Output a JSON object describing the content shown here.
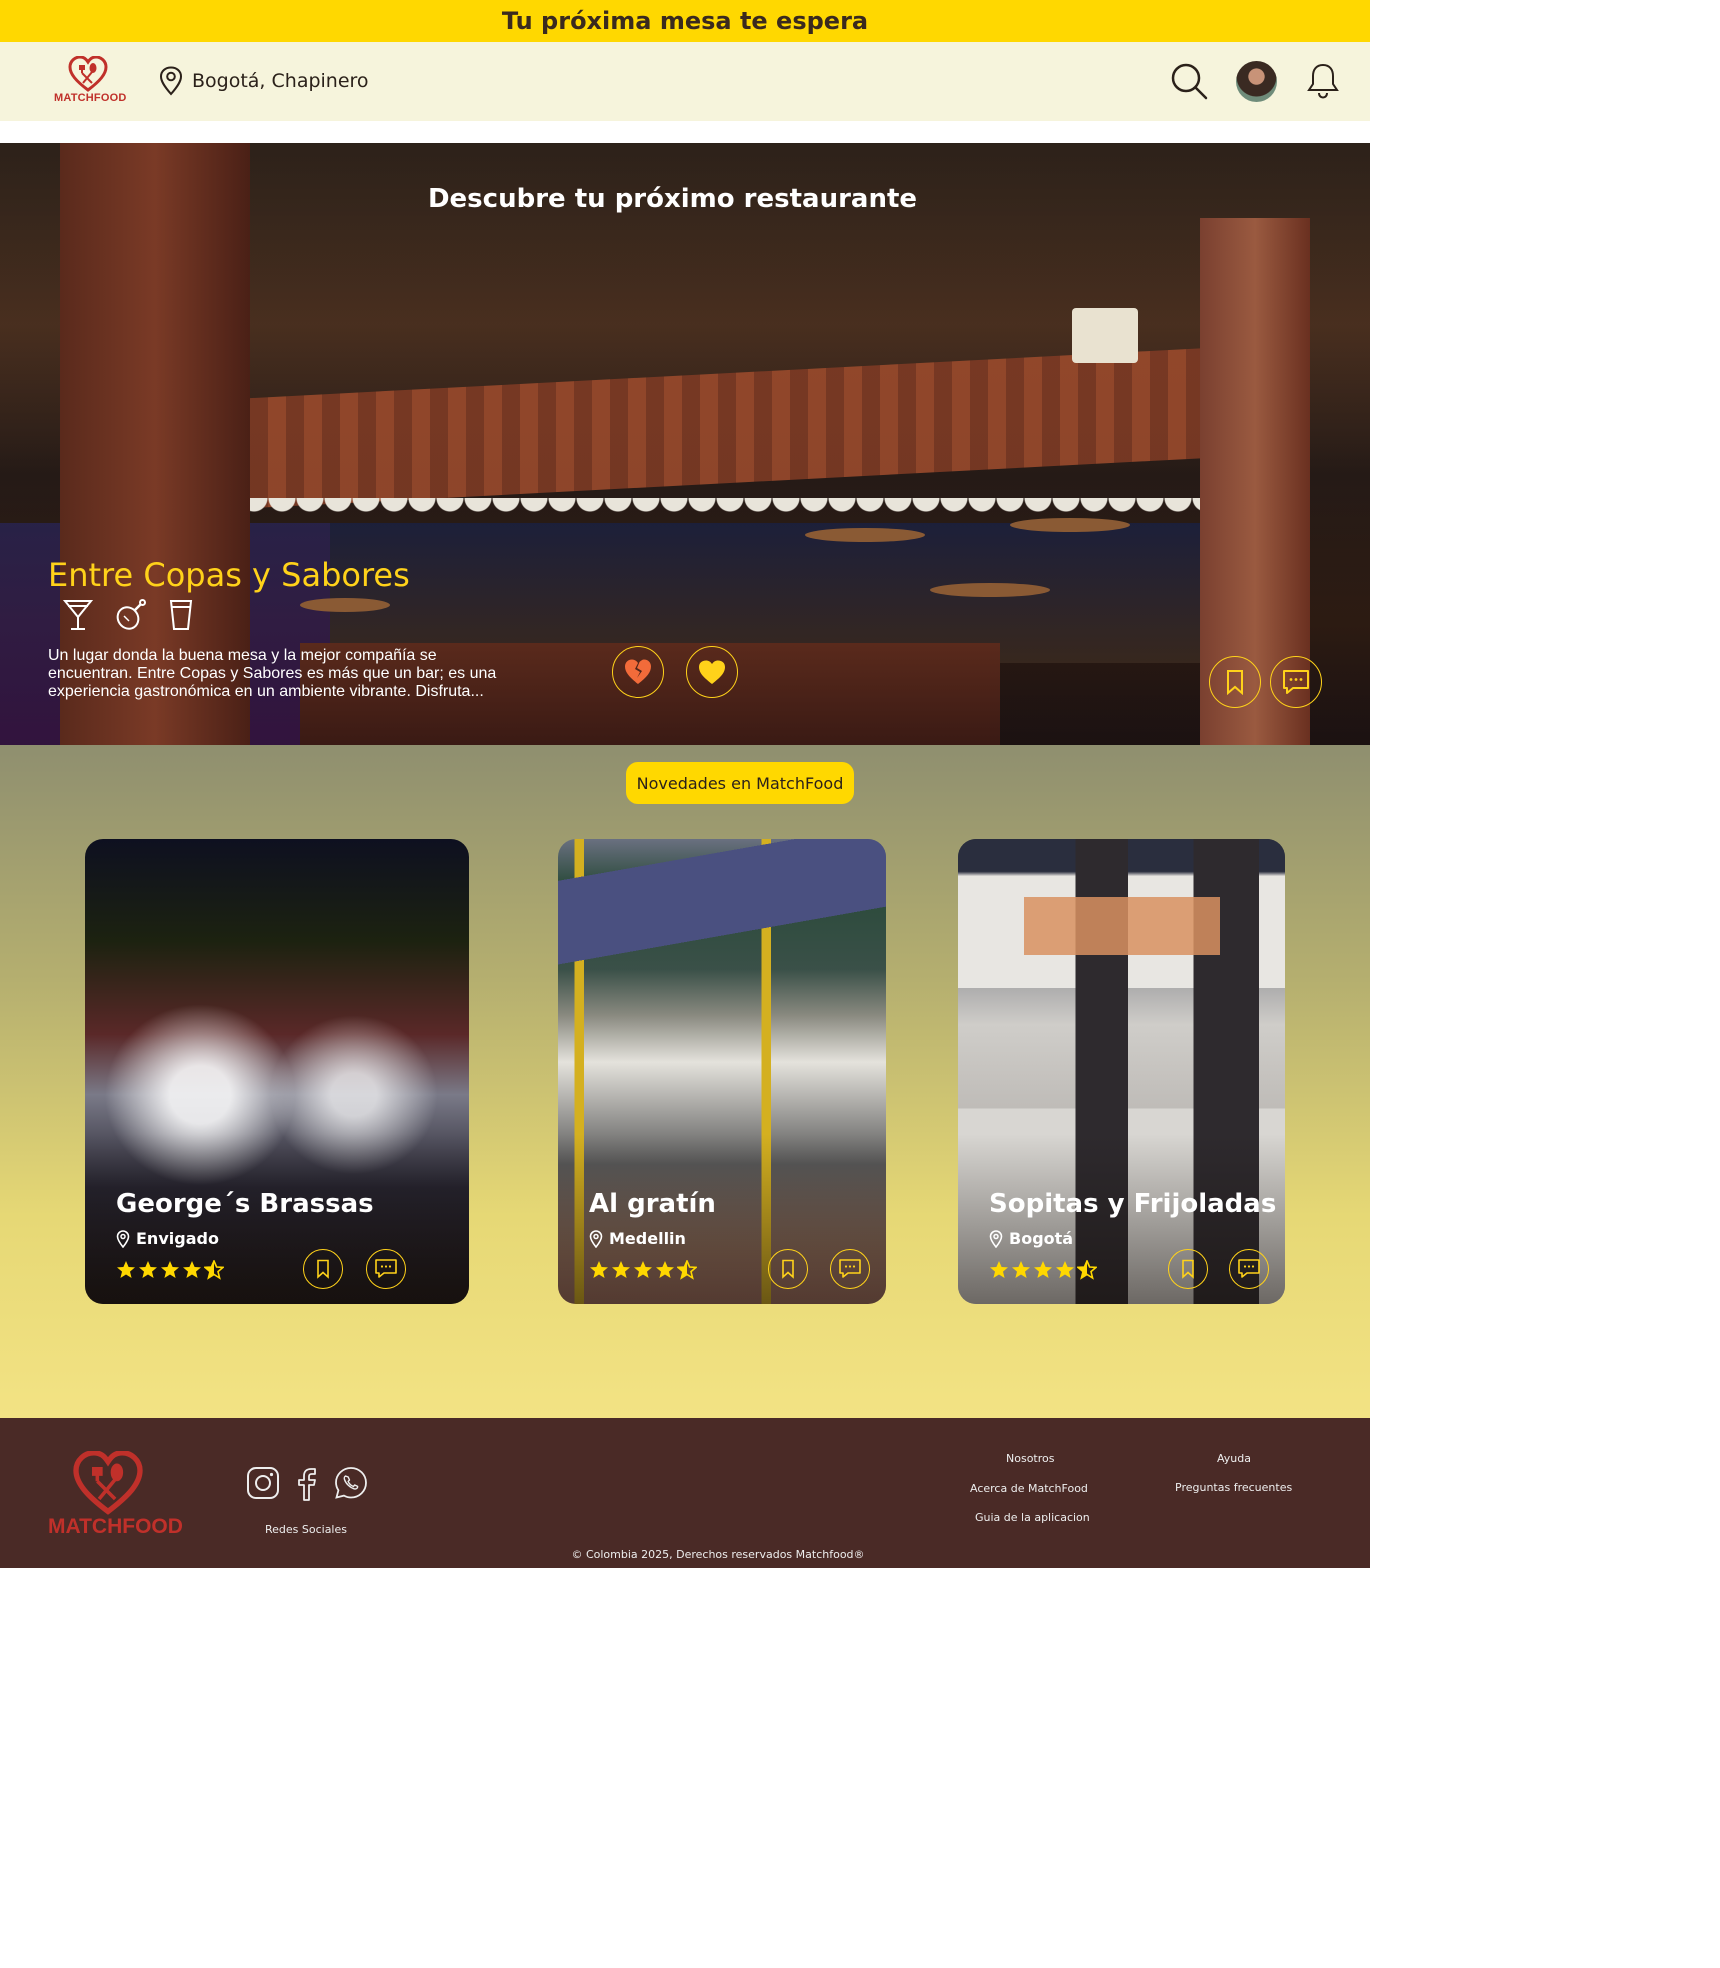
{
  "banner": {
    "text": "Tu próxima mesa te espera"
  },
  "header": {
    "logo_text": "MATCHFOOD",
    "location": "Bogotá, Chapinero"
  },
  "hero": {
    "title": "Descubre tu próximo restaurante",
    "restaurant_name": "Entre Copas y Sabores",
    "description": "Un lugar donda la buena mesa y la mejor compañía se encuentran. Entre Copas y Sabores es más que un bar; es una experiencia gastronómica en un ambiente vibrante. Disfruta...",
    "category_icons": [
      "cocktail-icon",
      "chicken-leg-icon",
      "beer-glass-icon"
    ]
  },
  "news": {
    "label": "Novedades en MatchFood",
    "cards": [
      {
        "name": "George´s Brassas",
        "location": "Envigado",
        "rating": 4.5
      },
      {
        "name": "Al gratín",
        "location": "Medellin",
        "rating": 4.5
      },
      {
        "name": "Sopitas y Frijoladas",
        "location": "Bogotá",
        "rating": 4.5
      }
    ]
  },
  "footer": {
    "logo_text": "MATCHFOOD",
    "socials_label": "Redes Sociales",
    "col1": {
      "title": "Nosotros",
      "links": [
        "Acerca de MatchFood",
        "Guia de la aplicacion"
      ]
    },
    "col2": {
      "title": "Ayuda",
      "links": [
        "Preguntas frecuentes"
      ]
    },
    "copyright": "© Colombia 2025, Derechos reservados Matchfood®"
  },
  "colors": {
    "accent": "#FFD800",
    "brand_red": "#C0302A",
    "footer_bg": "#4A2A26",
    "header_bg": "#F6F4DC"
  }
}
